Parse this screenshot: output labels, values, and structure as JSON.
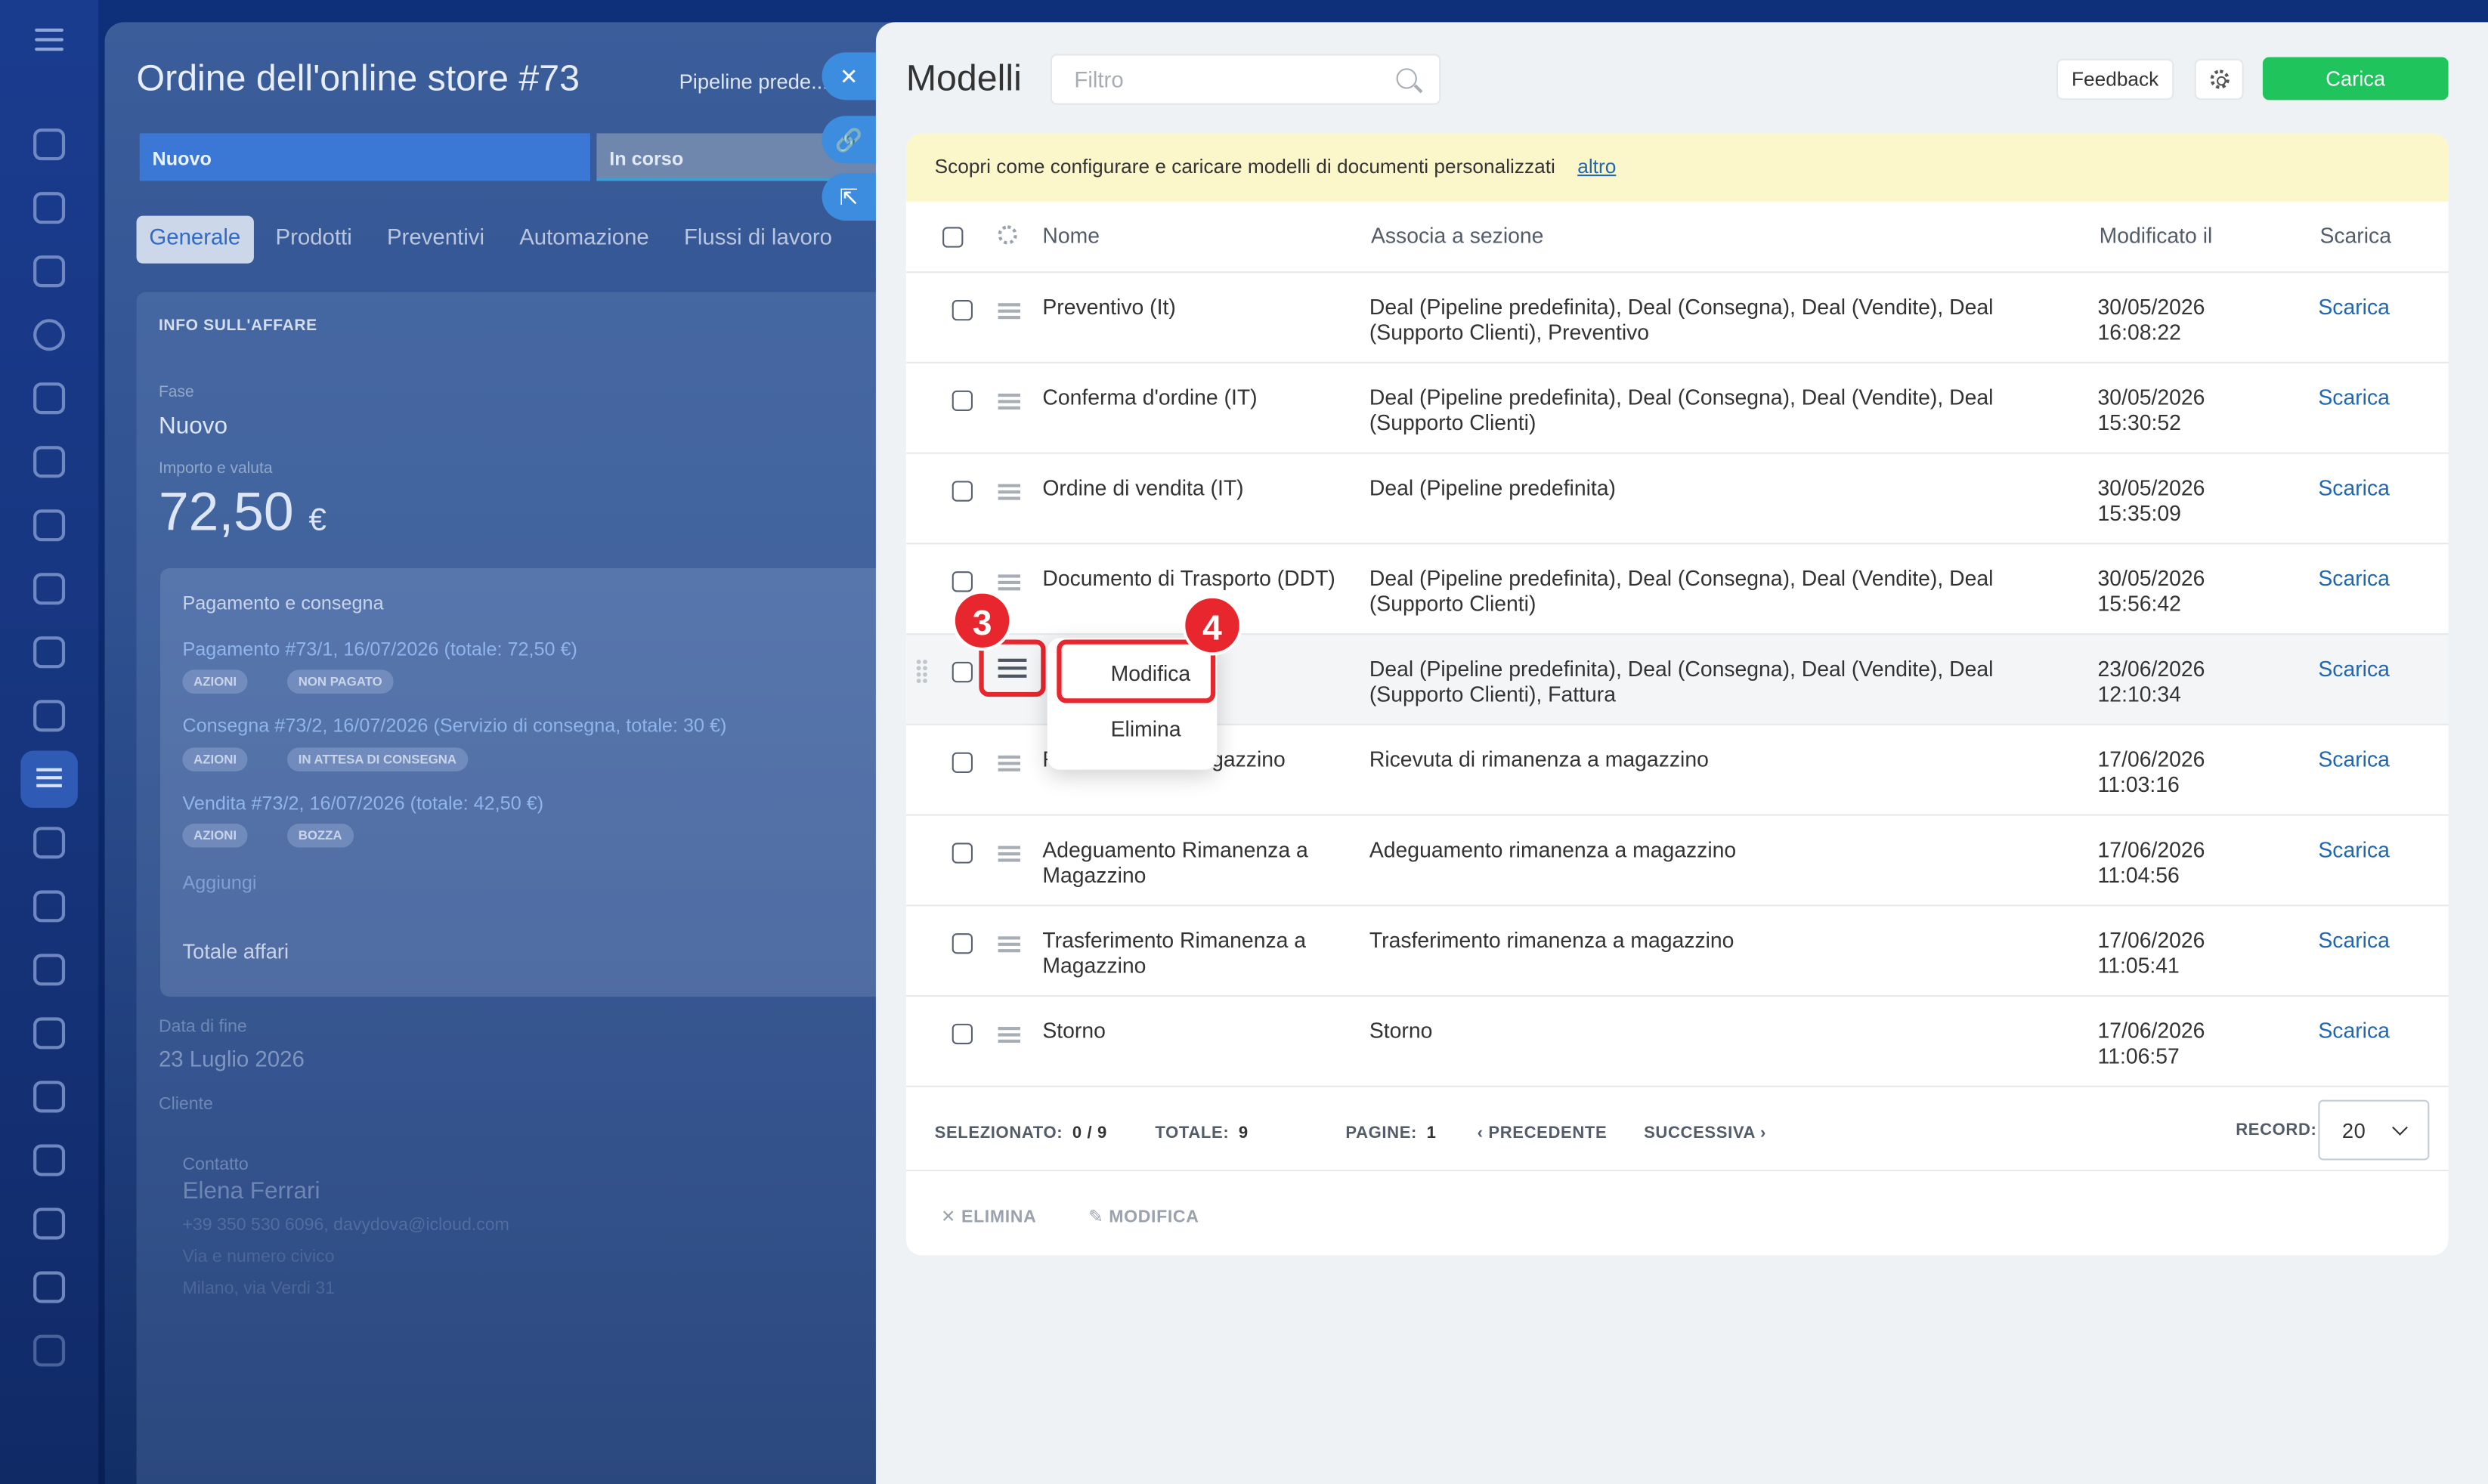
{
  "deal": {
    "title": "Ordine dell'online store #73",
    "pipeline": "Pipeline prede...",
    "stages": [
      "Nuovo",
      "In corso"
    ],
    "tabs": [
      "Generale",
      "Prodotti",
      "Preventivi",
      "Automazione",
      "Flussi di lavoro"
    ],
    "section_title": "INFO SULL'AFFARE",
    "fase_label": "Fase",
    "fase_value": "Nuovo",
    "amount_label": "Importo e valuta",
    "amount": "72,50",
    "currency": "€",
    "payments_title": "Pagamento e consegna",
    "payment_link": "Pagamento #73/1, 16/07/2026 (totale: 72,50 €)",
    "payment_status": "NON PAGATO",
    "delivery_link": "Consegna #73/2, 16/07/2026 (Servizio di consegna, totale: 30 €)",
    "delivery_status": "IN ATTESA DI CONSEGNA",
    "sale_link": "Vendita #73/2, 16/07/2026 (totale: 42,50 €)",
    "sale_status": "BOZZA",
    "actions_chip": "AZIONI",
    "add_link": "Aggiungi",
    "total_deals": "Totale affari",
    "end_date_label": "Data di fine",
    "end_date": "23 Luglio 2026",
    "client_label": "Cliente",
    "contact_label": "Contatto",
    "contact_name": "Elena Ferrari",
    "contact_info": "+39 350 530 6096, davydova@icloud.com",
    "address1": "Via e numero civico",
    "address2": "Milano, via Verdi 31"
  },
  "slider": {
    "title": "Modelli",
    "filter_placeholder": "Filtro",
    "feedback": "Feedback",
    "load": "Carica",
    "banner_text": "Scopri come configurare e caricare modelli di documenti personalizzati",
    "banner_link": "altro"
  },
  "table": {
    "headers": {
      "name": "Nome",
      "section": "Associa a sezione",
      "modified": "Modificato il",
      "download": "Scarica"
    },
    "rows": [
      {
        "name": "Preventivo (It)",
        "section": "Deal (Pipeline predefinita), Deal (Consegna), Deal (Vendite), Deal (Supporto Clienti), Preventivo",
        "date": "30/05/2026",
        "time": "16:08:22",
        "dl": "Scarica"
      },
      {
        "name": "Conferma d'ordine (IT)",
        "section": "Deal (Pipeline predefinita), Deal (Consegna), Deal (Vendite), Deal (Supporto Clienti)",
        "date": "30/05/2026",
        "time": "15:30:52",
        "dl": "Scarica"
      },
      {
        "name": "Ordine di vendita (IT)",
        "section": "Deal (Pipeline predefinita)",
        "date": "30/05/2026",
        "time": "15:35:09",
        "dl": "Scarica"
      },
      {
        "name": "Documento di Trasporto (DDT)",
        "section": "Deal (Pipeline predefinita), Deal (Consegna), Deal (Vendite), Deal (Supporto Clienti)",
        "date": "30/05/2026",
        "time": "15:56:42",
        "dl": "Scarica"
      },
      {
        "name": "",
        "section": "Deal (Pipeline predefinita), Deal (Consegna), Deal (Vendite), Deal (Supporto Clienti), Fattura",
        "date": "23/06/2026",
        "time": "12:10:34",
        "dl": "Scarica"
      },
      {
        "name": "R... ...nenza a Magazzino",
        "section": "Ricevuta di rimanenza a magazzino",
        "date": "17/06/2026",
        "time": "11:03:16",
        "dl": "Scarica"
      },
      {
        "name": "Adeguamento Rimanenza a Magazzino",
        "section": "Adeguamento rimanenza a magazzino",
        "date": "17/06/2026",
        "time": "11:04:56",
        "dl": "Scarica"
      },
      {
        "name": "Trasferimento Rimanenza a Magazzino",
        "section": "Trasferimento rimanenza a magazzino",
        "date": "17/06/2026",
        "time": "11:05:41",
        "dl": "Scarica"
      },
      {
        "name": "Storno",
        "section": "Storno",
        "date": "17/06/2026",
        "time": "11:06:57",
        "dl": "Scarica"
      }
    ]
  },
  "footer": {
    "selected_label": "SELEZIONATO:",
    "selected_value": "0 / 9",
    "total_label": "TOTALE:",
    "total_value": "9",
    "pages_label": "PAGINE:",
    "pages_value": "1",
    "prev": "PRECEDENTE",
    "next": "SUCCESSIVA",
    "records_label": "RECORD:",
    "records_value": "20",
    "delete": "ELIMINA",
    "edit": "MODIFICA"
  },
  "context_menu": {
    "edit": "Modifica",
    "delete": "Elimina"
  },
  "callouts": {
    "menu_step": "3",
    "edit_step": "4"
  },
  "colors": {
    "accent_green": "#1fc55c",
    "link_blue": "#2067b0",
    "highlight_red": "#e8262d",
    "banner_yellow": "#fcf7cb"
  }
}
